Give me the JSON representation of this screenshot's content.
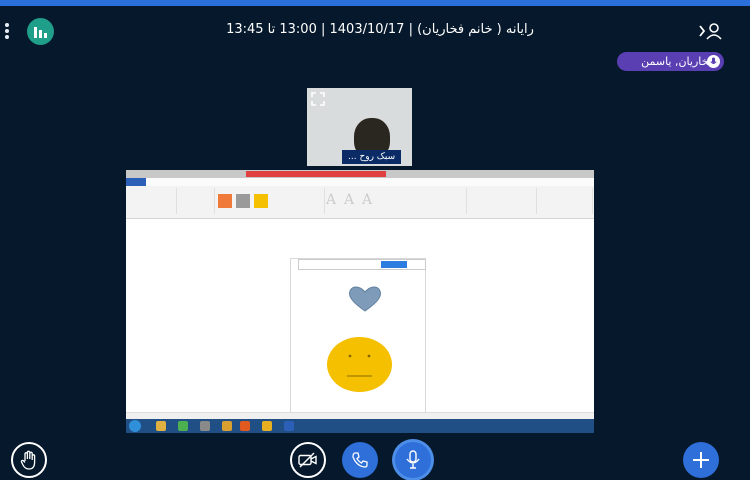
{
  "header": {
    "title": "رایانه ( خانم فخاریان) | 1403/10/17 | 13:00 تا 13:45"
  },
  "talking_indicator": {
    "name": "فخاریان, یاسمن"
  },
  "webcam": {
    "name": "سبک روح ..."
  },
  "colors": {
    "background": "#06182b",
    "accent": "#2e6fd9",
    "talker": "#5a3fb3",
    "stats": "#1f9e8a"
  },
  "icons": {
    "menu": "kebab-icon",
    "stats": "bar-chart-icon",
    "users": "user-icon",
    "raise_hand": "hand-icon",
    "camera": "camera-off-icon",
    "phone": "phone-icon",
    "mic": "microphone-icon",
    "actions": "plus-icon"
  }
}
